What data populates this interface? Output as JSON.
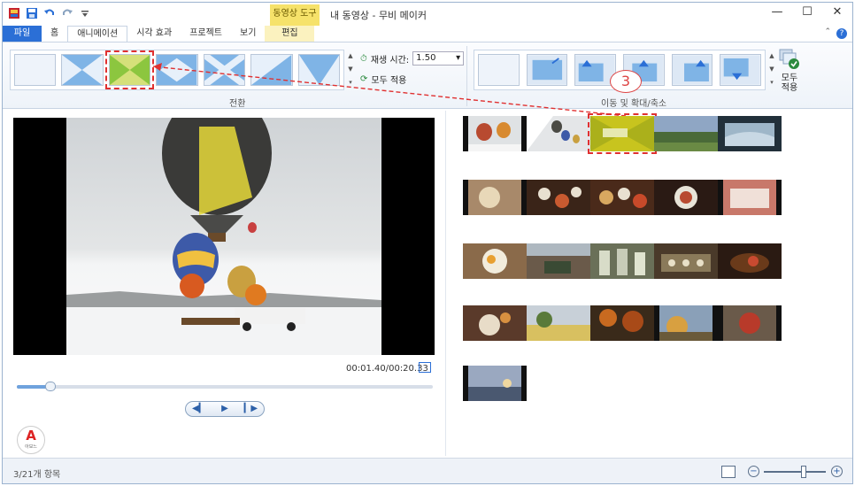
{
  "window": {
    "title": "내 동영상 - 무비 메이커",
    "context_tab_group": "동영상 도구",
    "controls": {
      "minimize": "—",
      "maximize": "☐",
      "close": "✕"
    }
  },
  "tabs": [
    {
      "label": "파일"
    },
    {
      "label": "홈"
    },
    {
      "label": "애니메이션"
    },
    {
      "label": "시각 효과"
    },
    {
      "label": "프로젝트"
    },
    {
      "label": "보기"
    },
    {
      "label": "편집"
    }
  ],
  "ribbon": {
    "transitions": {
      "group_label": "전환",
      "duration_label": "재생 시간:",
      "duration_value": "1.50",
      "apply_all_label": "모두 적용"
    },
    "pan_zoom": {
      "group_label": "이동 및 확대/축소",
      "apply_all_label_1": "모두",
      "apply_all_label_2": "적용"
    }
  },
  "callout": {
    "number": "3"
  },
  "preview": {
    "timecode": "00:01.40/00:20.33",
    "seek_progress": 0.08
  },
  "playback": {
    "prev": "◀▎",
    "play": "▶",
    "next": "▎▶"
  },
  "logo": {
    "letter": "A",
    "caption": "아보느"
  },
  "status": {
    "item_count": "3/21개 항목"
  },
  "zoom": {
    "minus": "−",
    "plus": "+"
  },
  "colors": {
    "accent": "#2b6fd6",
    "selection": "#e03030",
    "context_tab": "#f6e26a"
  }
}
